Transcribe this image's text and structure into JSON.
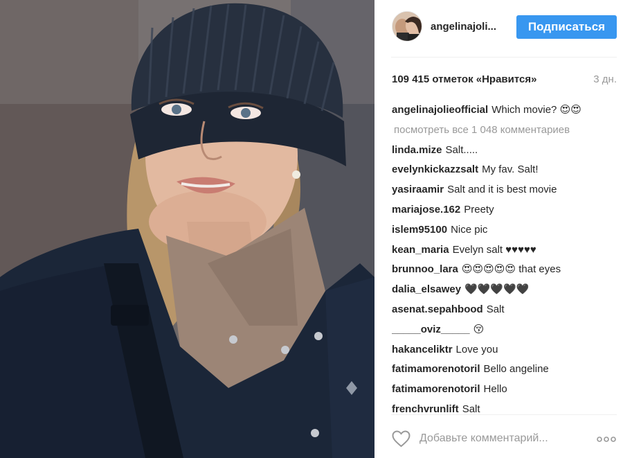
{
  "post": {
    "image_alt": "Woman in a dark knit beanie and navy jacket looking to the side"
  },
  "header": {
    "username": "angelinajoli...",
    "follow_label": "Подписаться",
    "accent_color": "#3897f0"
  },
  "stats": {
    "likes": "109 415 отметок «Нравится»",
    "time": "3 дн."
  },
  "caption": {
    "user": "angelinajolieofficial",
    "text": "Which movie? 😍😍"
  },
  "view_all_comments": "посмотреть все 1 048 комментариев",
  "comments": [
    {
      "user": "linda.mize",
      "text": "Salt....."
    },
    {
      "user": "evelynkickazzsalt",
      "text": "My fav. Salt!"
    },
    {
      "user": "yasiraamir",
      "text": "Salt and it is best movie"
    },
    {
      "user": "mariajose.162",
      "text": "Preety"
    },
    {
      "user": "islem95100",
      "text": "Nice pic"
    },
    {
      "user": "kean_maria",
      "text": "Evelyn salt ♥♥♥♥♥"
    },
    {
      "user": "brunnoo_lara",
      "text": "😍😍😍😍😍 that eyes"
    },
    {
      "user": "dalia_elsawey",
      "text": "🖤🖤🖤🖤🖤"
    },
    {
      "user": "asenat.sepahbood",
      "text": "Salt"
    },
    {
      "user": "_____oviz_____",
      "text": "😚"
    },
    {
      "user": "hakanceliktr",
      "text": "Love you"
    },
    {
      "user": "fatimamorenotoril",
      "text": "Bello angeline"
    },
    {
      "user": "fatimamorenotoril",
      "text": "Hello"
    },
    {
      "user": "frenchvrunlift",
      "text": "Salt"
    }
  ],
  "footer": {
    "comment_placeholder": "Добавьте комментарий...",
    "like_icon": "heart-outline-icon",
    "more_icon": "more-dots-icon"
  }
}
